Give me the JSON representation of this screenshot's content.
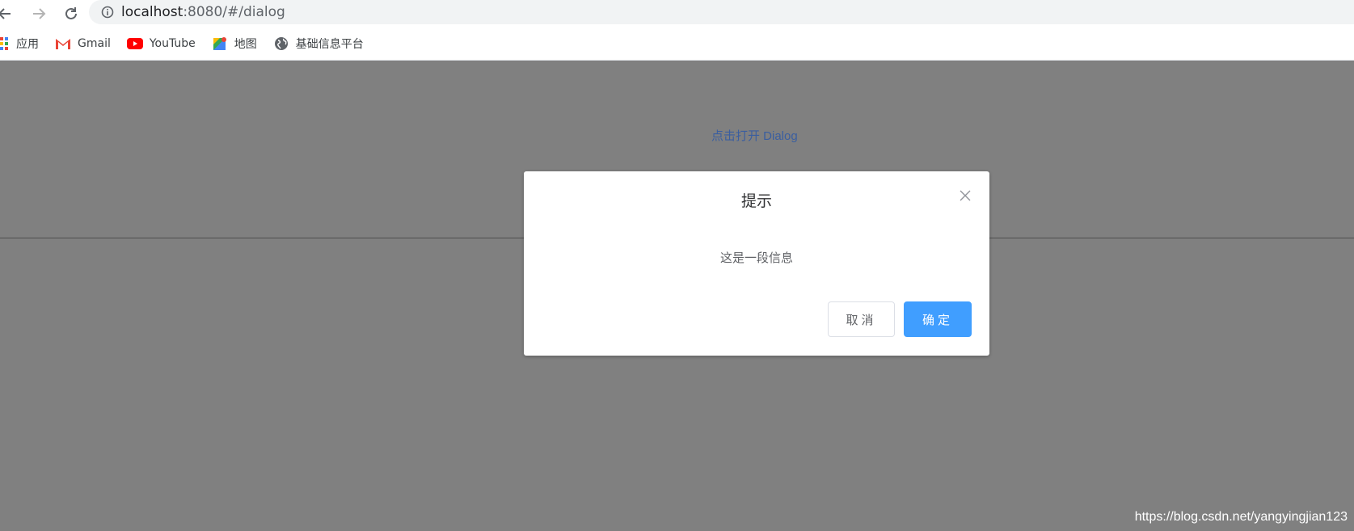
{
  "browser": {
    "url_host": "localhost",
    "url_rest": ":8080/#/dialog",
    "bookmarks": [
      {
        "label": "应用",
        "icon": "apps-grid-icon"
      },
      {
        "label": "Gmail",
        "icon": "gmail-icon"
      },
      {
        "label": "YouTube",
        "icon": "youtube-icon"
      },
      {
        "label": "地图",
        "icon": "maps-icon"
      },
      {
        "label": "基础信息平台",
        "icon": "globe-icon"
      }
    ]
  },
  "page": {
    "open_link": "点击打开 Dialog"
  },
  "dialog": {
    "title": "提示",
    "message": "这是一段信息",
    "cancel_label": "取消",
    "confirm_label": "确定"
  },
  "watermark": "https://blog.csdn.net/yangyingjian123",
  "colors": {
    "overlay": "#808080",
    "primary": "#409eff",
    "link": "#3a5ea0"
  }
}
